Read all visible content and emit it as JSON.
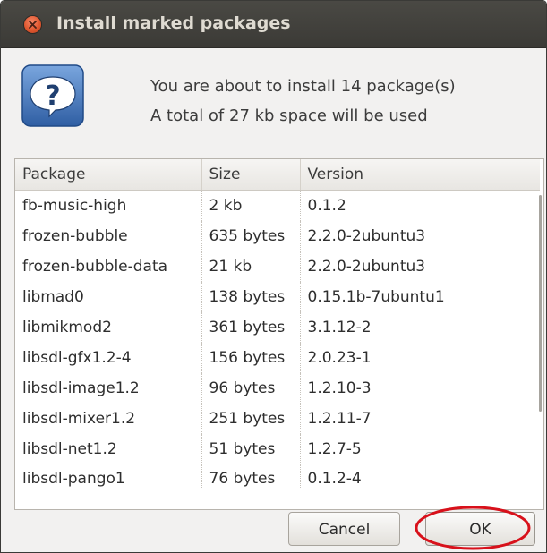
{
  "window": {
    "title": "Install marked packages"
  },
  "message": {
    "line1": "You are about to install 14 package(s)",
    "line2": "A total of 27 kb space will be used"
  },
  "table": {
    "columns": [
      "Package",
      "Size",
      "Version"
    ],
    "rows": [
      [
        "fb-music-high",
        "2 kb",
        "0.1.2"
      ],
      [
        "frozen-bubble",
        "635 bytes",
        "2.2.0-2ubuntu3"
      ],
      [
        "frozen-bubble-data",
        "21 kb",
        "2.2.0-2ubuntu3"
      ],
      [
        "libmad0",
        "138 bytes",
        "0.15.1b-7ubuntu1"
      ],
      [
        "libmikmod2",
        "361 bytes",
        "3.1.12-2"
      ],
      [
        "libsdl-gfx1.2-4",
        "156 bytes",
        "2.0.23-1"
      ],
      [
        "libsdl-image1.2",
        "96 bytes",
        "1.2.10-3"
      ],
      [
        "libsdl-mixer1.2",
        "251 bytes",
        "1.2.11-7"
      ],
      [
        "libsdl-net1.2",
        "51 bytes",
        "1.2.7-5"
      ],
      [
        "libsdl-pango1",
        "76 bytes",
        "0.1.2-4"
      ]
    ]
  },
  "buttons": {
    "cancel": "Cancel",
    "ok": "OK"
  },
  "icons": {
    "close": "close-icon",
    "dialog": "question-icon"
  },
  "colors": {
    "titlebar": "#3c3b37",
    "close": "#e0572f",
    "question_icon": "#3465a4",
    "annotation": "#d8111b"
  }
}
